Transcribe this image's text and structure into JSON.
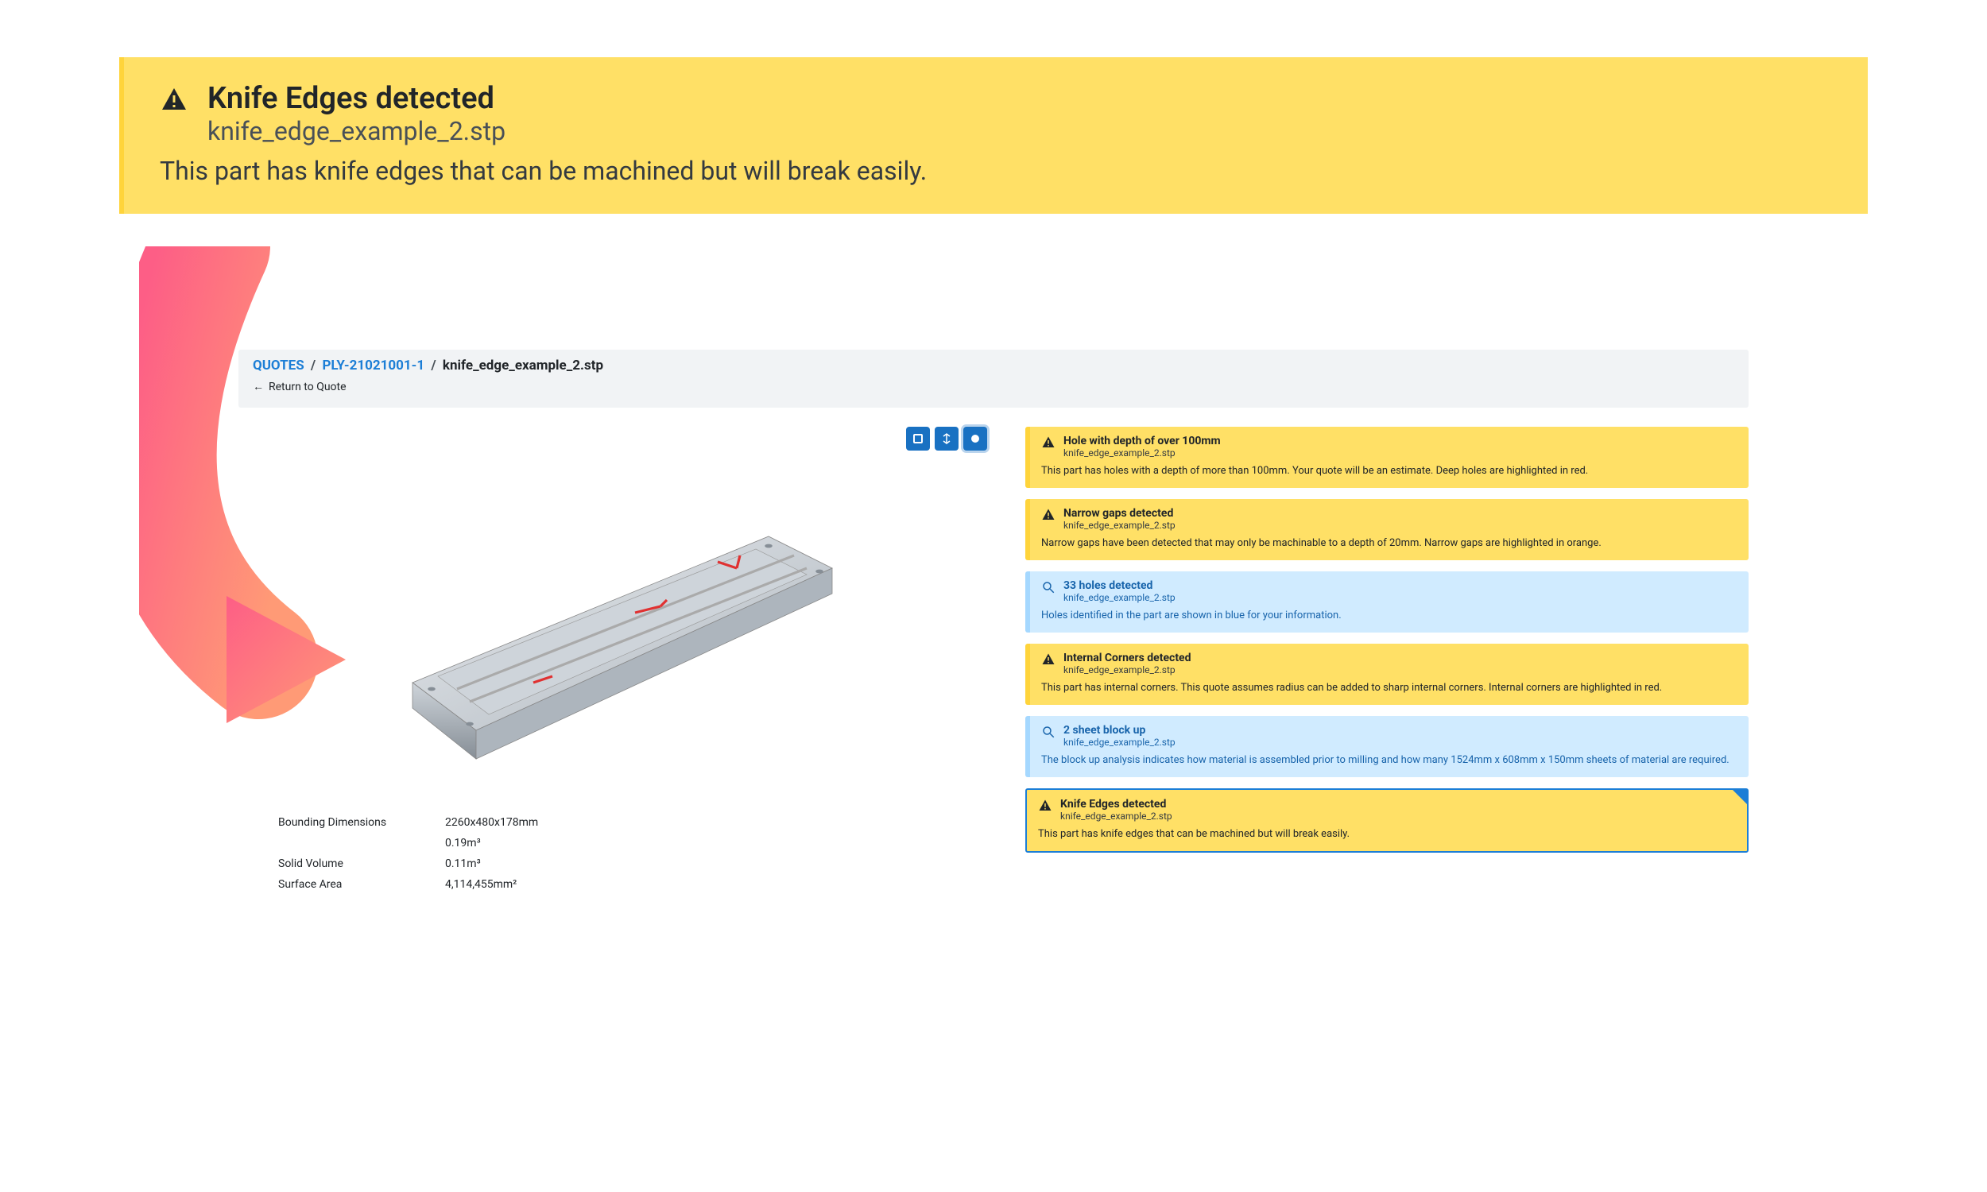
{
  "banner": {
    "title": "Knife Edges detected",
    "subtitle": "knife_edge_example_2.stp",
    "message": "This part has knife edges that can be machined but will break easily."
  },
  "breadcrumb": {
    "root": "QUOTES",
    "quote_id": "PLY-21021001-1",
    "filename": "knife_edge_example_2.stp",
    "return_label": "Return to Quote"
  },
  "dimensions": {
    "bounding_label": "Bounding Dimensions",
    "bounding_value": "2260x480x178mm",
    "bounding_volume": "0.19m³",
    "solid_label": "Solid Volume",
    "solid_value": "0.11m³",
    "surface_label": "Surface Area",
    "surface_value": "4,114,455mm²"
  },
  "issues": [
    {
      "severity": "warn",
      "title": "Hole with depth of over 100mm",
      "file": "knife_edge_example_2.stp",
      "message": "This part has holes with a depth of more than 100mm. Your quote will be an estimate. Deep holes are highlighted in red."
    },
    {
      "severity": "warn",
      "title": "Narrow gaps detected",
      "file": "knife_edge_example_2.stp",
      "message": "Narrow gaps have been detected that may only be machinable to a depth of 20mm. Narrow gaps are highlighted in orange."
    },
    {
      "severity": "info",
      "title": "33 holes detected",
      "file": "knife_edge_example_2.stp",
      "message": "Holes identified in the part are shown in blue for your information."
    },
    {
      "severity": "warn",
      "title": "Internal Corners detected",
      "file": "knife_edge_example_2.stp",
      "message": "This part has internal corners. This quote assumes radius can be added to sharp internal corners. Internal corners are highlighted in red."
    },
    {
      "severity": "info",
      "title": "2 sheet block up",
      "file": "knife_edge_example_2.stp",
      "message": "The block up analysis indicates how material is assembled prior to milling and how many 1524mm x 608mm x 150mm sheets of material are required."
    },
    {
      "severity": "warn",
      "title": "Knife Edges detected",
      "file": "knife_edge_example_2.stp",
      "message": "This part has knife edges that can be machined but will break easily."
    }
  ]
}
